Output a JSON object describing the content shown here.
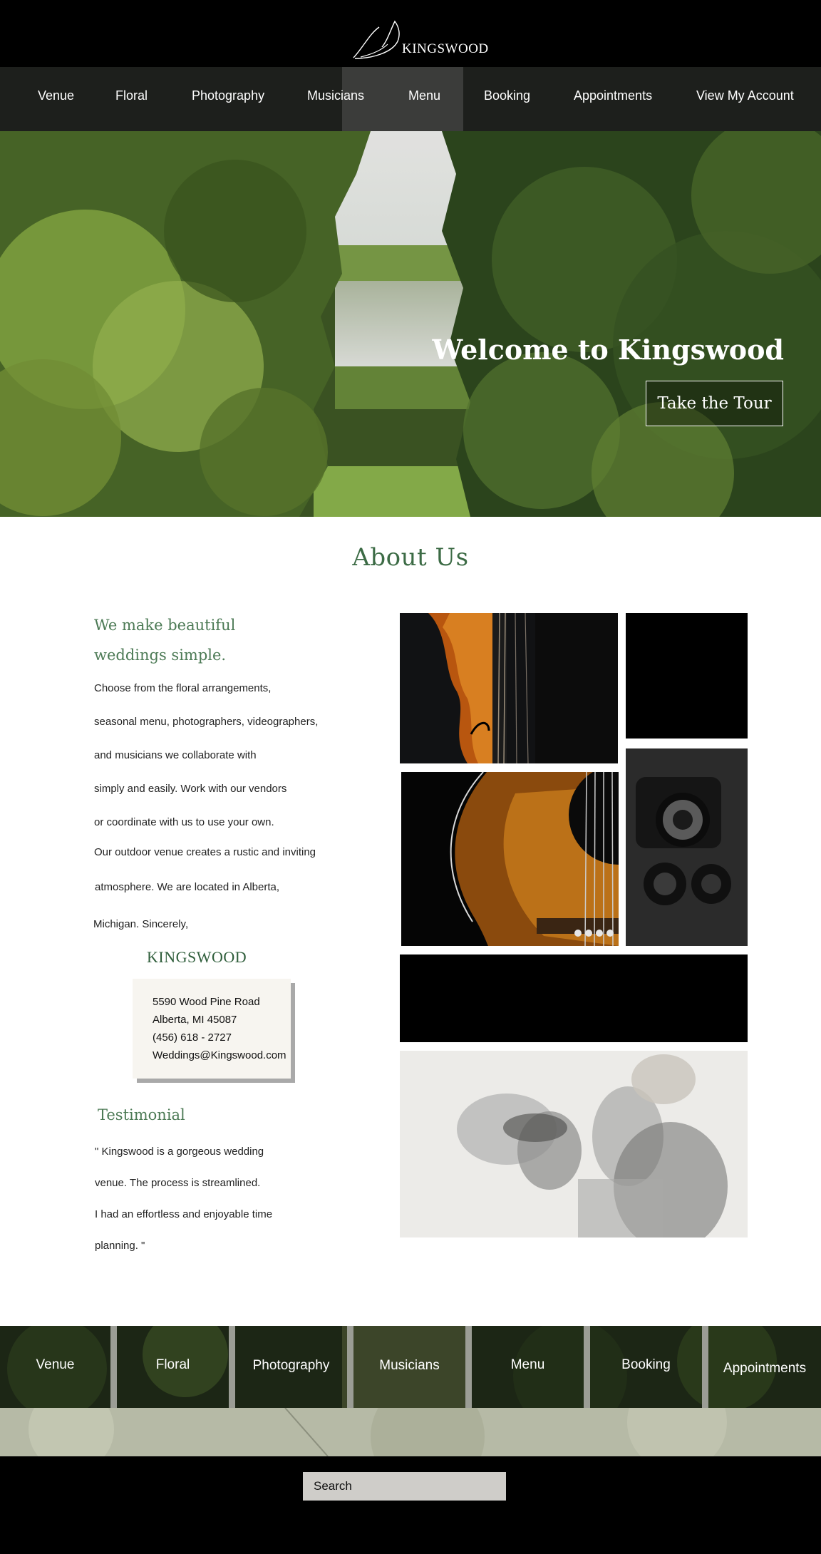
{
  "brand": {
    "name": "KINGSWOOD"
  },
  "nav": {
    "items": [
      "Venue",
      "Floral",
      "Photography",
      "Musicians",
      "Menu",
      "Booking",
      "Appointments"
    ],
    "account": "View My Account"
  },
  "hero": {
    "title": "Welcome to Kingswood",
    "cta": "Take the Tour"
  },
  "about": {
    "title": "About Us",
    "tagline_lines": [
      "We make beautiful",
      "weddings simple."
    ],
    "paragraph1": [
      "Choose from the floral arrangements,",
      "seasonal menu, photographers, videographers,",
      "and musicians we collaborate with",
      "simply and easily. Work with our vendors",
      "or coordinate with us to use your own."
    ],
    "paragraph2": [
      "Our outdoor venue creates a rustic and inviting",
      "atmosphere. We are located in Alberta,",
      "Michigan. Sincerely,"
    ],
    "signature": "KINGSWOOD",
    "contact": {
      "street": "5590 Wood Pine Road",
      "city": "Alberta, MI 45087",
      "phone": "(456) 618 - 2727",
      "email": "Weddings@Kingswood.com"
    },
    "testimonial_title": "Testimonial",
    "testimonial_lines": [
      "\"  Kingswood is a  gorgeous wedding",
      "venue. The process is streamlined.",
      "I had an effortless and enjoyable time",
      "planning. \""
    ]
  },
  "footer": {
    "items": [
      "Venue",
      "Floral",
      "Photography",
      "Musicians",
      "Menu",
      "Booking",
      "Appointments"
    ],
    "search_placeholder": "Search"
  },
  "colors": {
    "accent_green": "#4c7a55",
    "signature_green": "#2f5e3b",
    "header_bg": "#000000",
    "nav_bg": "#1d1f1c"
  },
  "icons": {
    "logo": "swan-leaf-logo"
  }
}
